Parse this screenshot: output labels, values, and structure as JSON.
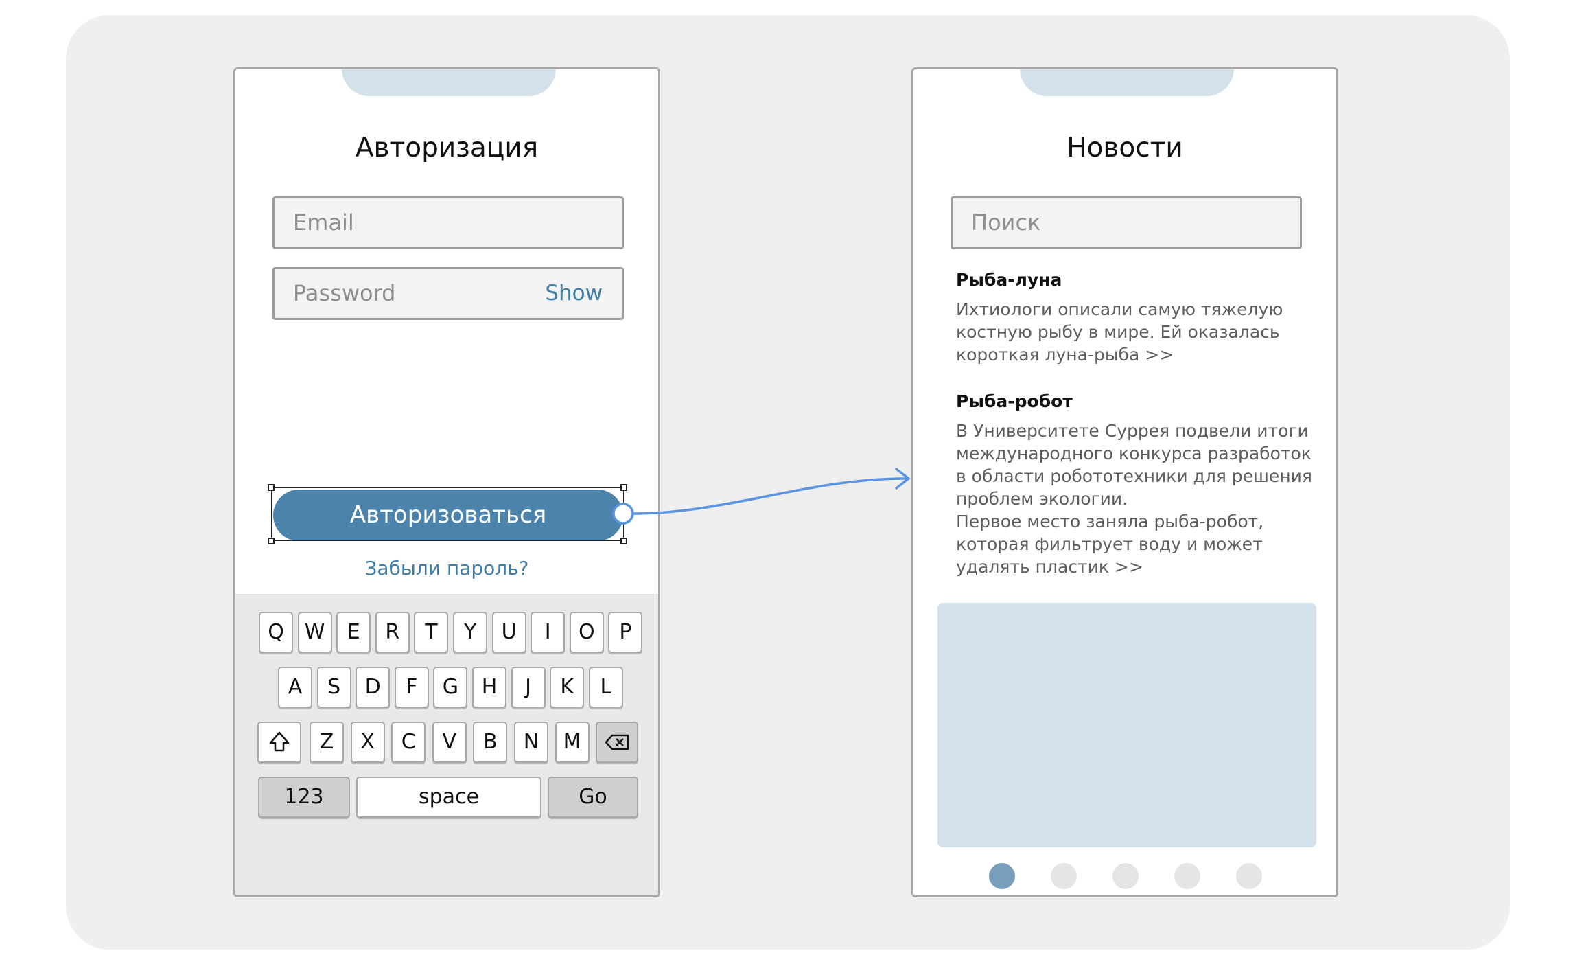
{
  "colors": {
    "background": "#efefef",
    "accent": "#4b83aa",
    "link": "#3f7ea6",
    "connector": "#5b95df",
    "placeholder_block": "#d3e1ea",
    "active_dot": "#789fbc"
  },
  "login_screen": {
    "title": "Авторизация",
    "email": {
      "placeholder": "Email",
      "value": ""
    },
    "password": {
      "placeholder": "Password",
      "value": "",
      "show_label": "Show"
    },
    "submit_label": "Авторизоваться",
    "forgot_label": "Забыли пароль?",
    "keyboard": {
      "row1": [
        "Q",
        "W",
        "E",
        "R",
        "T",
        "Y",
        "U",
        "I",
        "O",
        "P"
      ],
      "row2": [
        "A",
        "S",
        "D",
        "F",
        "G",
        "H",
        "J",
        "K",
        "L"
      ],
      "row3": [
        "Z",
        "X",
        "C",
        "V",
        "B",
        "N",
        "M"
      ],
      "shift_icon": "shift-icon",
      "backspace_icon": "backspace-icon",
      "numbers_label": "123",
      "space_label": "space",
      "go_label": "Go"
    }
  },
  "news_screen": {
    "title": "Новости",
    "search": {
      "placeholder": "Поиск",
      "value": ""
    },
    "items": [
      {
        "title": "Рыба-луна",
        "body": "Ихтиологи описали самую тяжелую костную рыбу в мире. Ей оказалась короткая луна-рыба >>"
      },
      {
        "title": "Рыба-робот",
        "body": "В Университете Суррея подвели итоги международного конкурса разработок в области робототехники для решения проблем экологии.\nПервое место заняла рыба-робот, которая фильтрует воду и может удалять пластик >>"
      }
    ],
    "pagination": {
      "total_pages": 5,
      "active_page": 1
    }
  },
  "flow": {
    "from": "login_screen.submit",
    "to": "news_screen"
  }
}
